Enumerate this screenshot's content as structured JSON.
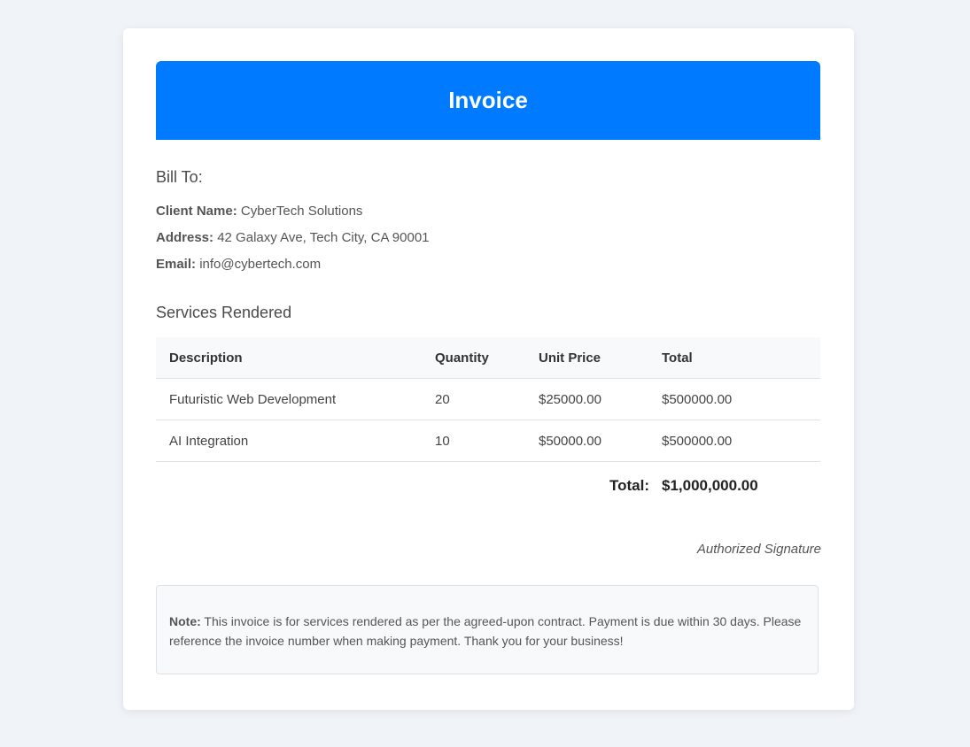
{
  "header": {
    "title": "Invoice"
  },
  "bill_to": {
    "title": "Bill To:",
    "client_label": "Client Name:",
    "client_value": "CyberTech Solutions",
    "address_label": "Address:",
    "address_value": "42 Galaxy Ave, Tech City, CA 90001",
    "email_label": "Email:",
    "email_value": "info@cybertech.com"
  },
  "services": {
    "title": "Services Rendered",
    "columns": [
      "Description",
      "Quantity",
      "Unit Price",
      "Total"
    ],
    "rows": [
      {
        "description": "Futuristic Web Development",
        "quantity": "20",
        "unit_price": "$25000.00",
        "total": "$500000.00"
      },
      {
        "description": "AI Integration",
        "quantity": "10",
        "unit_price": "$50000.00",
        "total": "$500000.00"
      }
    ],
    "total_label": "Total:",
    "total_value": "$1,000,000.00"
  },
  "signature": "Authorized Signature",
  "note": {
    "label": "Note:",
    "text": "This invoice is for services rendered as per the agreed-upon contract. Payment is due within 30 days. Please reference the invoice number when making payment. Thank you for your business!"
  },
  "colors": {
    "accent": "#007bff",
    "background": "#f0f3f7"
  }
}
